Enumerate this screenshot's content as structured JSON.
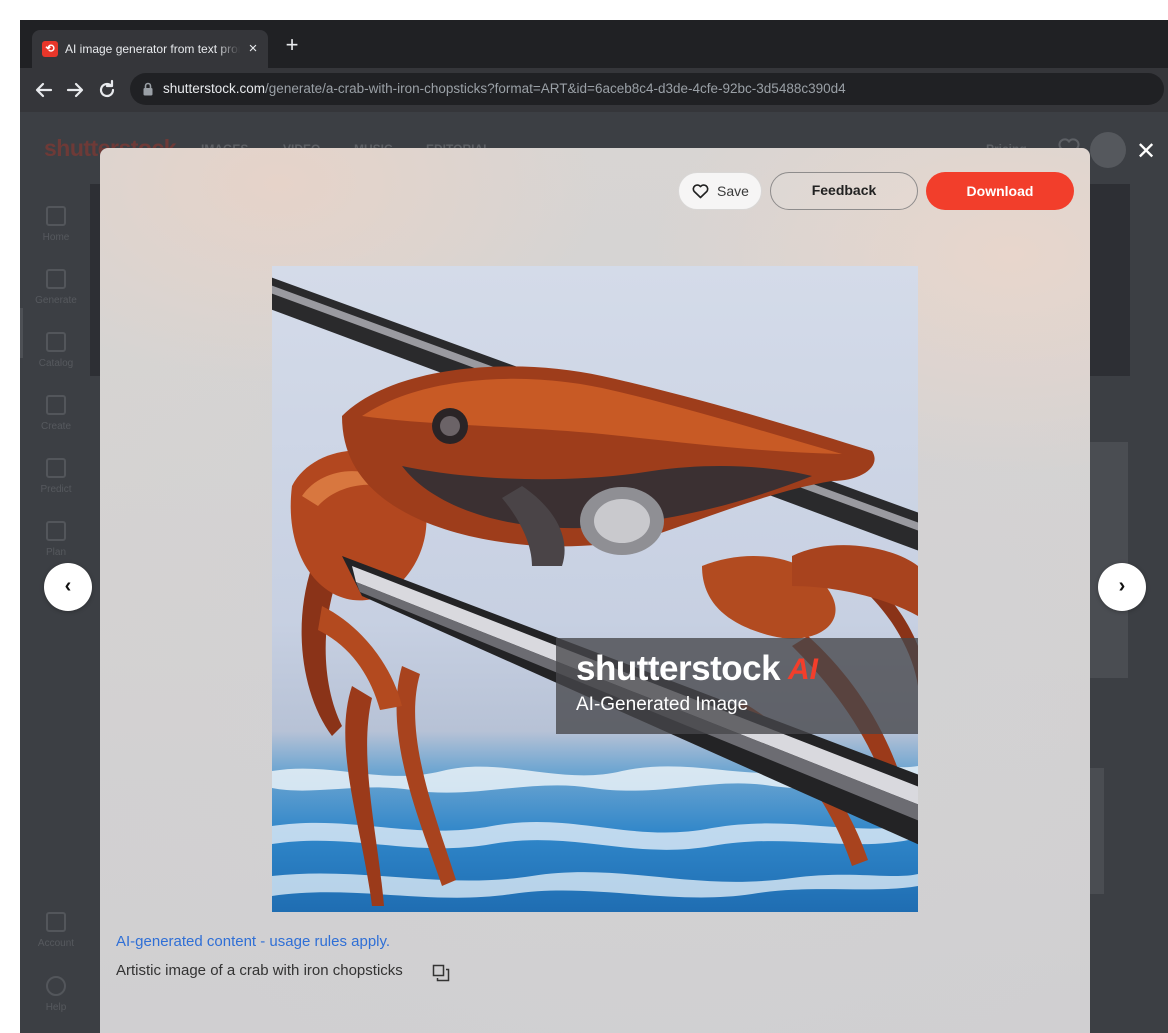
{
  "browser": {
    "tab_title": "AI image generator from text prompt",
    "favicon_glyph": "⟲",
    "tab_close": "×",
    "new_tab": "+",
    "url_host": "shutterstock.com",
    "url_path": "/generate/a-crab-with-iron-chopsticks?format=ART&id=6aceb8c4-d3de-4cfe-92bc-3d5488c390d4"
  },
  "site": {
    "logo": "shutterstock",
    "nav": [
      "IMAGES ⌄",
      "VIDEO ⌄",
      "MUSIC ⌄",
      "EDITORIAL ⌄"
    ],
    "pricing": "Pricing ⌄",
    "sidebar": [
      "Home",
      "Generate",
      "Catalog",
      "Create",
      "Predict",
      "Plan",
      "Account",
      "Help"
    ]
  },
  "modal": {
    "save_label": "Save",
    "feedback_label": "Feedback",
    "download_label": "Download",
    "prev_glyph": "‹",
    "next_glyph": "›",
    "close_glyph": "✕",
    "watermark_logo": "shutterstock",
    "watermark_ai": "AI",
    "watermark_subtitle": "AI-Generated Image",
    "usage_link": "AI-generated content - usage rules apply.",
    "caption": "Artistic image of a crab with iron chopsticks"
  },
  "colors": {
    "accent_red": "#f23e2b",
    "link_blue": "#2f6fd6"
  }
}
